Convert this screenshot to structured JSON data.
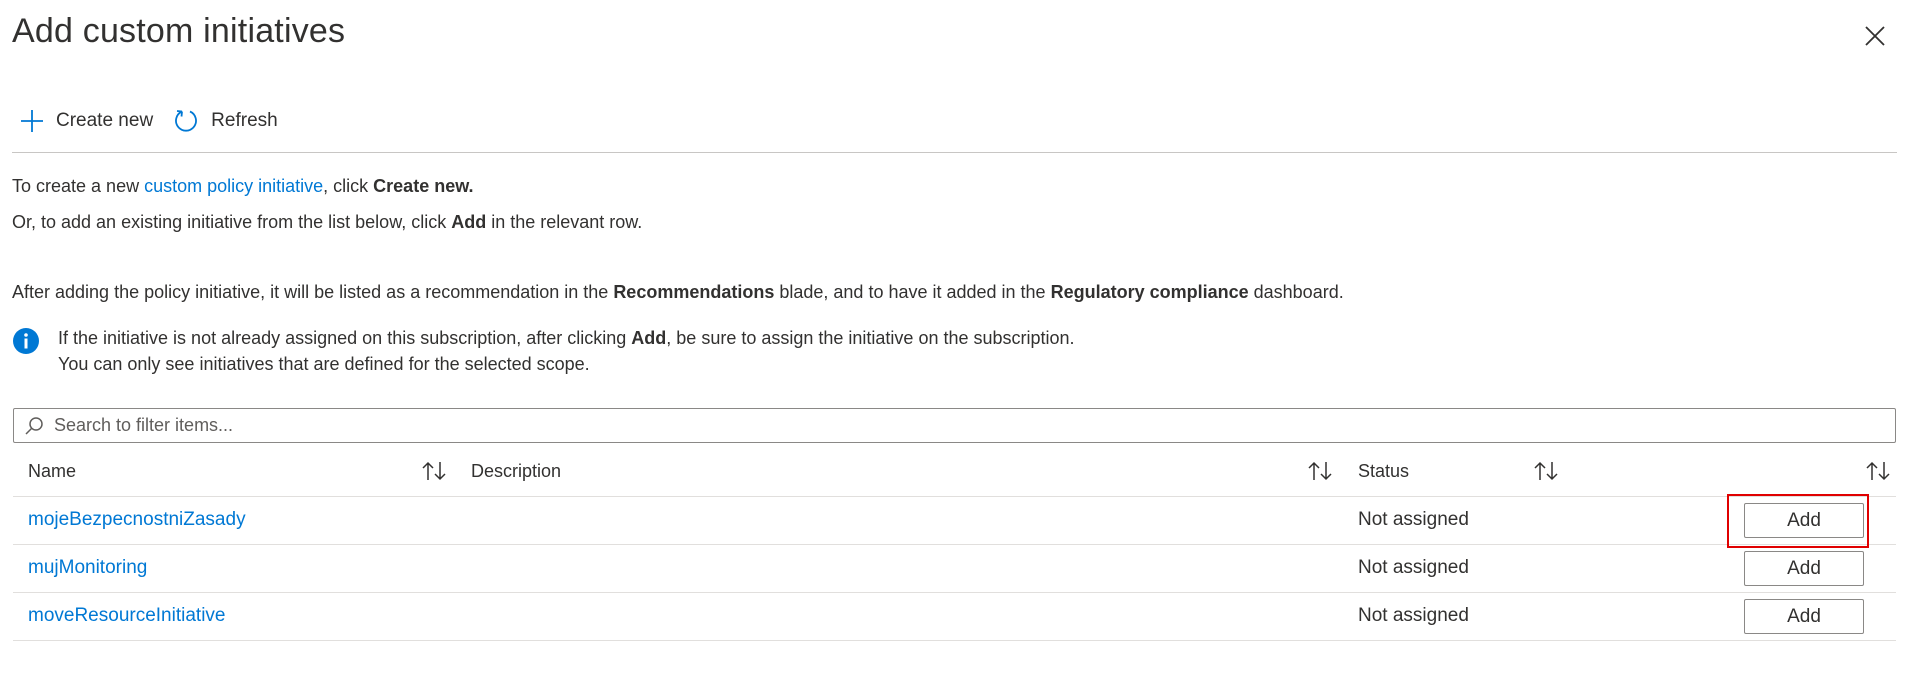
{
  "title": "Add custom initiatives",
  "toolbar": {
    "create_label": "Create new",
    "refresh_label": "Refresh"
  },
  "intro": {
    "line1_pre": "To create a new ",
    "line1_link": "custom policy initiative",
    "line1_mid": ", click ",
    "line1_bold": "Create new.",
    "line2_pre": "Or, to add an existing initiative from the list below, click ",
    "line2_bold": "Add",
    "line2_post": " in the relevant row.",
    "line3_pre": "After adding the policy initiative, it will be listed as a recommendation in the ",
    "line3_bold1": "Recommendations",
    "line3_mid": " blade, and to have it added in the ",
    "line3_bold2": "Regulatory compliance",
    "line3_post": " dashboard."
  },
  "info": {
    "line1_pre": "If the initiative is not already assigned on this subscription, after clicking ",
    "line1_bold": "Add",
    "line1_post": ", be sure to assign the initiative on the subscription.",
    "line2": "You can only see initiatives that are defined for the selected scope."
  },
  "search": {
    "placeholder": "Search to filter items..."
  },
  "table": {
    "columns": {
      "name": "Name",
      "description": "Description",
      "status": "Status"
    },
    "rows": [
      {
        "name": "mojeBezpecnostniZasady",
        "description": "",
        "status": "Not assigned",
        "action": "Add",
        "highlighted": true
      },
      {
        "name": "mujMonitoring",
        "description": "",
        "status": "Not assigned",
        "action": "Add",
        "highlighted": false
      },
      {
        "name": "moveResourceInitiative",
        "description": "",
        "status": "Not assigned",
        "action": "Add",
        "highlighted": false
      }
    ]
  },
  "colors": {
    "accent": "#0078d4",
    "highlight": "#e00000",
    "text": "#323130"
  }
}
